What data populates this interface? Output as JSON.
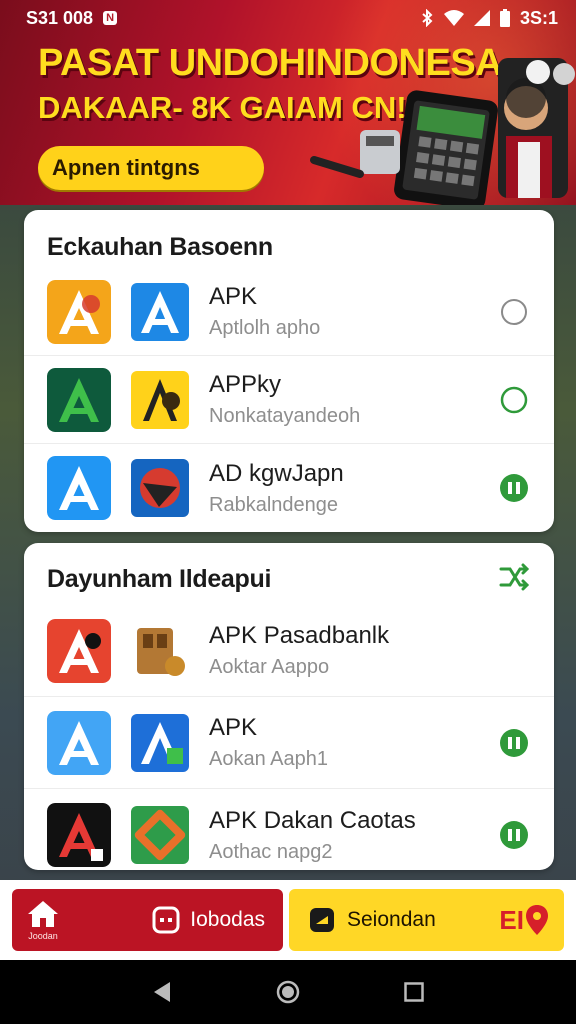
{
  "status_bar": {
    "time": "S31 008",
    "badge": "N",
    "clock_right": "3S:1",
    "icons": [
      "bluetooth-icon",
      "wifi-icon",
      "signal-icon",
      "battery-icon"
    ]
  },
  "banner": {
    "title": "PASAT UNDOHINDONESA",
    "subtitle": "DAKAAR- 8K GAIAM CN!",
    "cta_label": "Apnen tintgns"
  },
  "sections": [
    {
      "title": "Eckauhan Basoenn",
      "action_icon": "",
      "rows": [
        {
          "title": "APK",
          "subtitle": "Aptlolh apho",
          "status": "radio-empty-gray",
          "icon1": "app-a-orange",
          "icon2": "app-a-blue"
        },
        {
          "title": "APPky",
          "subtitle": "Nonkatayandeoh",
          "status": "radio-empty-green",
          "icon1": "app-a-green",
          "icon2": "app-a-yellow"
        },
        {
          "title": "AD kgwJapn",
          "subtitle": "Rabkalndenge",
          "status": "installed-green",
          "icon1": "app-a-blue",
          "icon2": "app-red-blue"
        }
      ]
    },
    {
      "title": "Dayunham Ildeapui",
      "action_icon": "shuffle-icon",
      "rows": [
        {
          "title": "APK Pasadbanlk",
          "subtitle": "Aoktar Aappo",
          "status": "none",
          "icon1": "app-a-red",
          "icon2": "app-brown"
        },
        {
          "title": "APK",
          "subtitle": "Aokan Aaph1",
          "status": "installed-green",
          "icon1": "app-a-lightblue",
          "icon2": "app-a-blue-green"
        },
        {
          "title": "APK Dakan Caotas",
          "subtitle": "Aothac napg2",
          "status": "installed-green",
          "icon1": "app-a-black",
          "icon2": "app-green-orange"
        }
      ]
    }
  ],
  "bottom_nav": {
    "home_label": "Joodan",
    "red_label": "Iobodas",
    "yellow_label": "Seiondan",
    "yellow_badge": "EI"
  },
  "colors": {
    "banner_red": "#b0122a",
    "banner_yellow": "#ffdd1f",
    "accent_green": "#2f9a3a",
    "nav_red": "#bb1424",
    "nav_yellow": "#ffd726"
  }
}
